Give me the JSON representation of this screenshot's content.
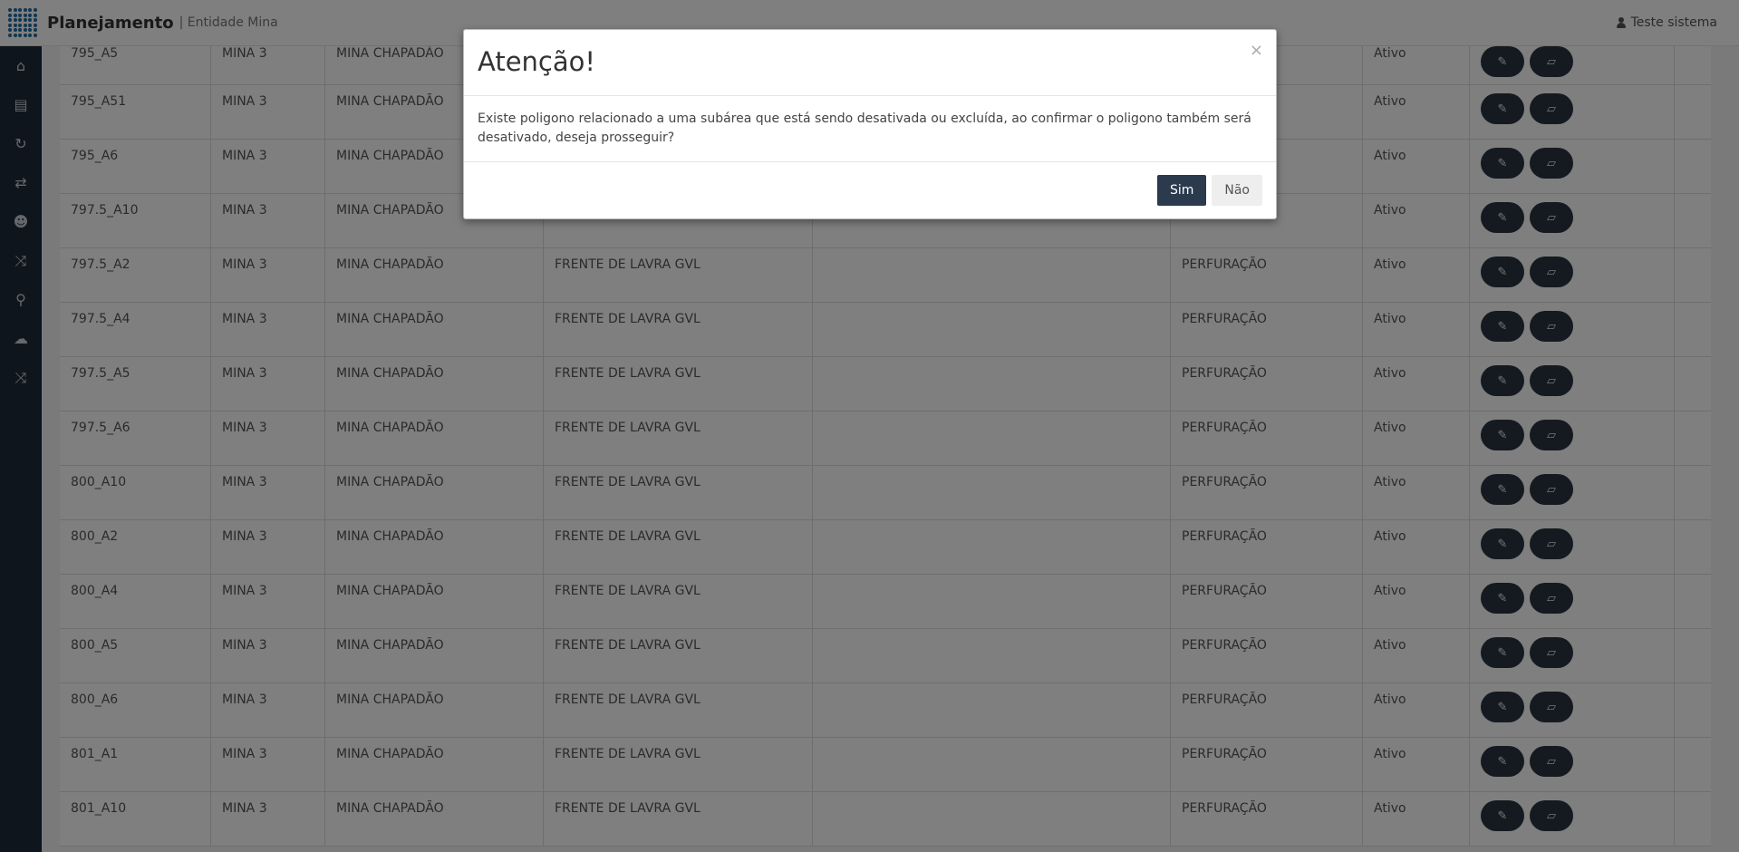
{
  "header": {
    "app_title": "Planejamento",
    "separator": "| Entidade Mina",
    "user_name": "Teste sistema"
  },
  "sidebar": {
    "items": [
      {
        "icon": "home-icon"
      },
      {
        "icon": "book-icon"
      },
      {
        "icon": "refresh-icon"
      },
      {
        "icon": "exchange-icon"
      },
      {
        "icon": "users-icon"
      },
      {
        "icon": "shuffle-icon"
      },
      {
        "icon": "pin-icon"
      },
      {
        "icon": "cloud-upload-icon"
      },
      {
        "icon": "random-icon"
      }
    ]
  },
  "table": {
    "rows": [
      {
        "code": "795_A5",
        "mina": "MINA 3",
        "chapadao": "MINA CHAPADÃO",
        "frente": "",
        "obs": "",
        "operacao": "",
        "status": "Ativo"
      },
      {
        "code": "795_A51",
        "mina": "MINA 3",
        "chapadao": "MINA CHAPADÃO",
        "frente": "",
        "obs": "",
        "operacao": "",
        "status": "Ativo"
      },
      {
        "code": "795_A6",
        "mina": "MINA 3",
        "chapadao": "MINA CHAPADÃO",
        "frente": "",
        "obs": "",
        "operacao": "",
        "status": "Ativo"
      },
      {
        "code": "797.5_A10",
        "mina": "MINA 3",
        "chapadao": "MINA CHAPADÃO",
        "frente": "",
        "obs": "",
        "operacao": "",
        "status": "Ativo"
      },
      {
        "code": "797.5_A2",
        "mina": "MINA 3",
        "chapadao": "MINA CHAPADÃO",
        "frente": "FRENTE DE LAVRA GVL",
        "obs": "",
        "operacao": "PERFURAÇÃO",
        "status": "Ativo"
      },
      {
        "code": "797.5_A4",
        "mina": "MINA 3",
        "chapadao": "MINA CHAPADÃO",
        "frente": "FRENTE DE LAVRA GVL",
        "obs": "",
        "operacao": "PERFURAÇÃO",
        "status": "Ativo"
      },
      {
        "code": "797.5_A5",
        "mina": "MINA 3",
        "chapadao": "MINA CHAPADÃO",
        "frente": "FRENTE DE LAVRA GVL",
        "obs": "",
        "operacao": "PERFURAÇÃO",
        "status": "Ativo"
      },
      {
        "code": "797.5_A6",
        "mina": "MINA 3",
        "chapadao": "MINA CHAPADÃO",
        "frente": "FRENTE DE LAVRA GVL",
        "obs": "",
        "operacao": "PERFURAÇÃO",
        "status": "Ativo"
      },
      {
        "code": "800_A10",
        "mina": "MINA 3",
        "chapadao": "MINA CHAPADÃO",
        "frente": "FRENTE DE LAVRA GVL",
        "obs": "",
        "operacao": "PERFURAÇÃO",
        "status": "Ativo"
      },
      {
        "code": "800_A2",
        "mina": "MINA 3",
        "chapadao": "MINA CHAPADÃO",
        "frente": "FRENTE DE LAVRA GVL",
        "obs": "",
        "operacao": "PERFURAÇÃO",
        "status": "Ativo"
      },
      {
        "code": "800_A4",
        "mina": "MINA 3",
        "chapadao": "MINA CHAPADÃO",
        "frente": "FRENTE DE LAVRA GVL",
        "obs": "",
        "operacao": "PERFURAÇÃO",
        "status": "Ativo"
      },
      {
        "code": "800_A5",
        "mina": "MINA 3",
        "chapadao": "MINA CHAPADÃO",
        "frente": "FRENTE DE LAVRA GVL",
        "obs": "",
        "operacao": "PERFURAÇÃO",
        "status": "Ativo"
      },
      {
        "code": "800_A6",
        "mina": "MINA 3",
        "chapadao": "MINA CHAPADÃO",
        "frente": "FRENTE DE LAVRA GVL",
        "obs": "",
        "operacao": "PERFURAÇÃO",
        "status": "Ativo"
      },
      {
        "code": "801_A1",
        "mina": "MINA 3",
        "chapadao": "MINA CHAPADÃO",
        "frente": "FRENTE DE LAVRA GVL",
        "obs": "",
        "operacao": "PERFURAÇÃO",
        "status": "Ativo"
      },
      {
        "code": "801_A10",
        "mina": "MINA 3",
        "chapadao": "MINA CHAPADÃO",
        "frente": "FRENTE DE LAVRA GVL",
        "obs": "",
        "operacao": "PERFURAÇÃO",
        "status": "Ativo"
      }
    ]
  },
  "modal": {
    "title": "Atenção!",
    "close": "×",
    "message": "Existe poligono relacionado a uma subárea que está sendo desativada ou excluída, ao confirmar o poligono também será desativado, deseja prosseguir?",
    "confirm_label": "Sim",
    "cancel_label": "Não"
  }
}
